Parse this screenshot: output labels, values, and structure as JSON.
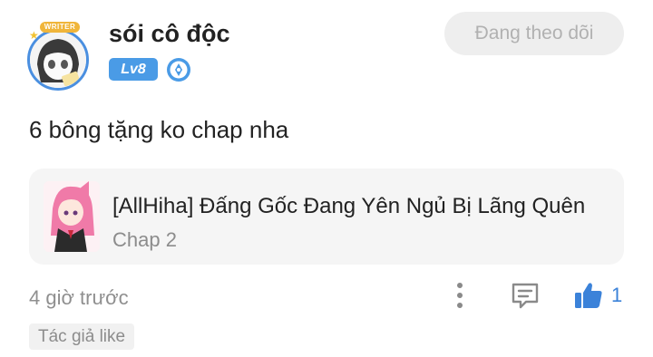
{
  "user": {
    "name": "sói cô độc",
    "level": "Lv8",
    "avatar_badge": "WRITER"
  },
  "follow_button": {
    "label": "Đang theo dõi"
  },
  "comment": {
    "text": "6 bông tặng ko chap nha"
  },
  "chapter_card": {
    "title": "[AllHiha] Đấng Gốc Đang Yên Ngủ Bị Lãng Quên",
    "chapter": "Chap 2"
  },
  "footer": {
    "time_ago": "4 giờ trước",
    "like_count": "1",
    "author_like_tag": "Tác giả like"
  },
  "icons": {
    "verified": "verified-badge-icon",
    "more": "more-vertical-icon",
    "reply": "comment-icon",
    "like": "thumbs-up-icon"
  },
  "colors": {
    "accent": "#3b82d9",
    "level_badge": "#4a9be6",
    "follow_bg": "#eeeeee",
    "card_bg": "#f5f5f5"
  }
}
